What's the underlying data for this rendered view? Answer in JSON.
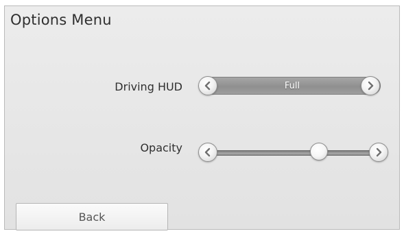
{
  "header": {
    "title": "Options Menu"
  },
  "driving_hud": {
    "label": "Driving HUD",
    "value": "Full",
    "prev_icon": "chevron-left-icon",
    "next_icon": "chevron-right-icon"
  },
  "opacity": {
    "label": "Opacity",
    "level_fraction": 0.68,
    "prev_icon": "chevron-left-icon",
    "next_icon": "chevron-right-icon"
  },
  "footer": {
    "back_label": "Back"
  },
  "colors": {
    "panel_background": "#e6e6e6",
    "select_bar": "#999999",
    "text": "#2f2f2f"
  }
}
